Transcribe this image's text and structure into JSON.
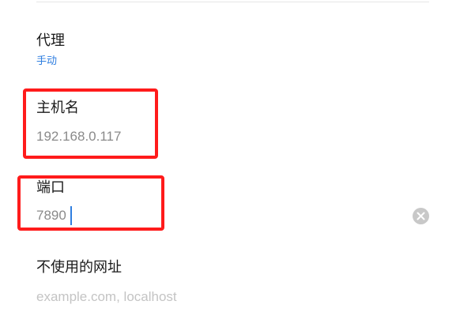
{
  "proxy": {
    "title": "代理",
    "value": "手动"
  },
  "hostname": {
    "title": "主机名",
    "value": "192.168.0.117"
  },
  "port": {
    "title": "端口",
    "value": "7890",
    "clear_icon": "clear-icon"
  },
  "bypass": {
    "title": "不使用的网址",
    "placeholder": "example.com, localhost"
  },
  "colors": {
    "link": "#2f7ee0",
    "highlight": "#ff1b1b",
    "value_text": "#8a8a8a",
    "placeholder_text": "#c4c4c4"
  }
}
